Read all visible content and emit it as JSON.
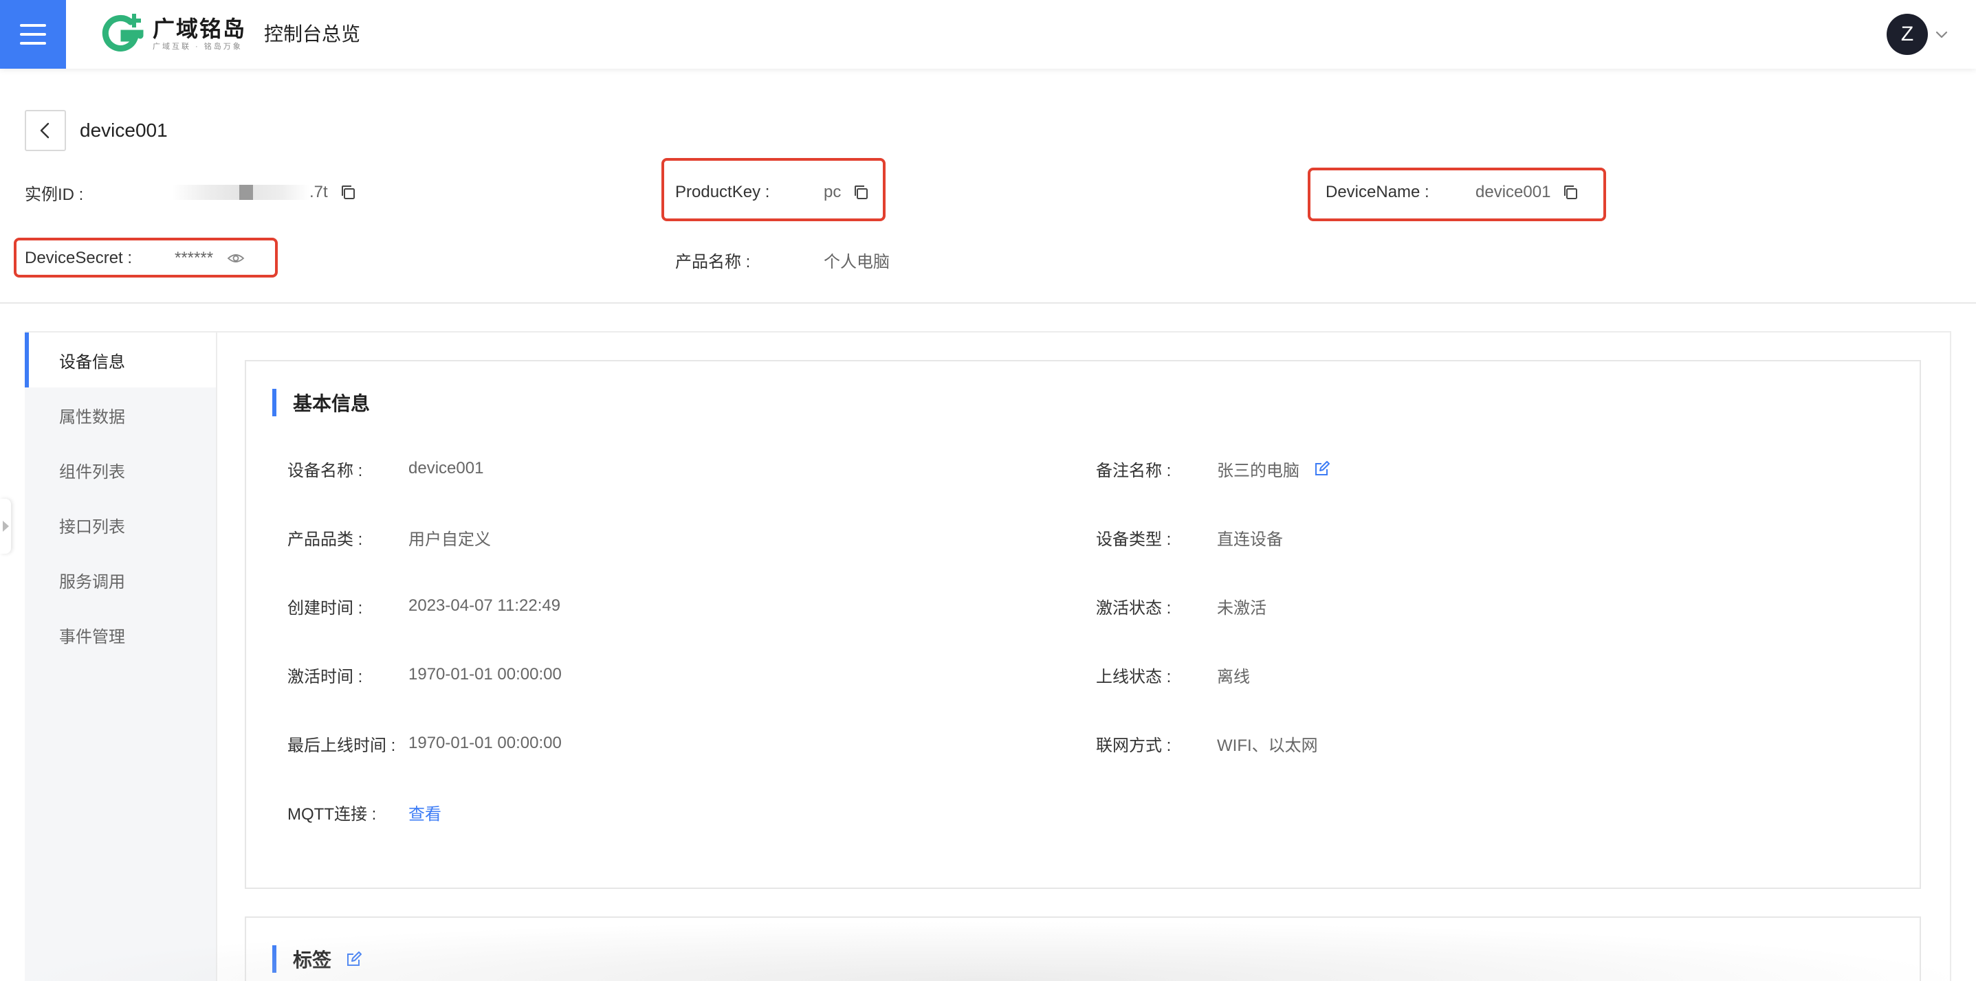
{
  "topbar": {
    "logo_name": "广域铭岛",
    "logo_slogan": "广域互联 · 铭岛万象",
    "console_title": "控制台总览",
    "avatar_letter": "Z",
    "accent_color": "#3d7cf5",
    "icons": [
      "menu-icon",
      "logo-icon",
      "chevron-down-icon"
    ]
  },
  "device": {
    "title": "device001",
    "instance_id": {
      "label": "实例ID :",
      "value_suffix": ".7t"
    },
    "product_key": {
      "label": "ProductKey :",
      "value": "pc"
    },
    "device_name": {
      "label": "DeviceName :",
      "value": "device001"
    },
    "device_secret": {
      "label": "DeviceSecret :",
      "value": "******"
    },
    "product_name": {
      "label": "产品名称 :",
      "value": "个人电脑"
    },
    "highlight_color": "#e2402f"
  },
  "tabs": [
    {
      "label": "设备信息",
      "active": true
    },
    {
      "label": "属性数据",
      "active": false
    },
    {
      "label": "组件列表",
      "active": false
    },
    {
      "label": "接口列表",
      "active": false
    },
    {
      "label": "服务调用",
      "active": false
    },
    {
      "label": "事件管理",
      "active": false
    }
  ],
  "basic_info": {
    "title": "基本信息",
    "left": [
      {
        "label": "设备名称 :",
        "value": "device001"
      },
      {
        "label": "产品品类 :",
        "value": "用户自定义"
      },
      {
        "label": "创建时间 :",
        "value": "2023-04-07 11:22:49"
      },
      {
        "label": "激活时间 :",
        "value": "1970-01-01 00:00:00"
      },
      {
        "label": "最后上线时间 :",
        "value": "1970-01-01 00:00:00"
      },
      {
        "label": "MQTT连接 :",
        "value": "查看"
      }
    ],
    "right": [
      {
        "label": "备注名称 :",
        "value": "张三的电脑"
      },
      {
        "label": "设备类型 :",
        "value": "直连设备"
      },
      {
        "label": "激活状态 :",
        "value": "未激活"
      },
      {
        "label": "上线状态 :",
        "value": "离线"
      },
      {
        "label": "联网方式 :",
        "value": "WIFI、以太网"
      }
    ]
  },
  "tags": {
    "title": "标签"
  }
}
